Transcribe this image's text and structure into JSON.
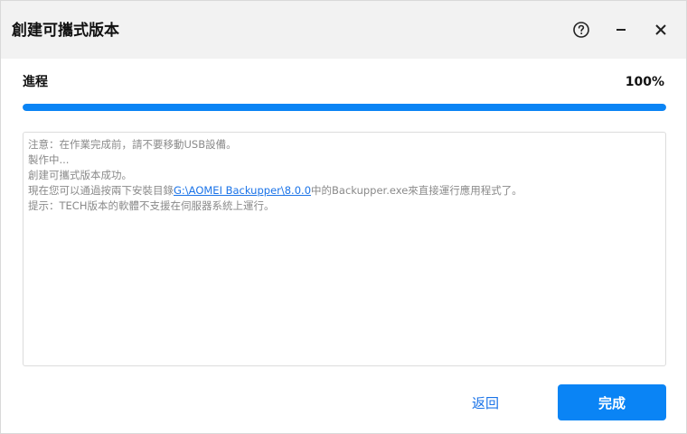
{
  "window": {
    "title": "創建可攜式版本"
  },
  "titlebar_icons": {
    "help": "help-circle-icon",
    "minimize": "minimize-icon",
    "close": "close-icon"
  },
  "progress": {
    "label": "進程",
    "percent_text": "100%",
    "value": 100
  },
  "log": {
    "line1": "注意：在作業完成前，請不要移動USB設備。",
    "line2": "製作中...",
    "line3": "創建可攜式版本成功。",
    "line4_prefix": "現在您可以通過按兩下安裝目錄",
    "line4_link": "G:\\AOMEI Backupper\\8.0.0",
    "line4_suffix": "中的Backupper.exe來直接運行應用程式了。",
    "line5": "提示：TECH版本的軟體不支援在伺服器系統上運行。"
  },
  "buttons": {
    "back": "返回",
    "finish": "完成"
  },
  "colors": {
    "accent": "#0a84f5",
    "link": "#1a73e8",
    "titlebar_bg": "#f2f2f2"
  }
}
